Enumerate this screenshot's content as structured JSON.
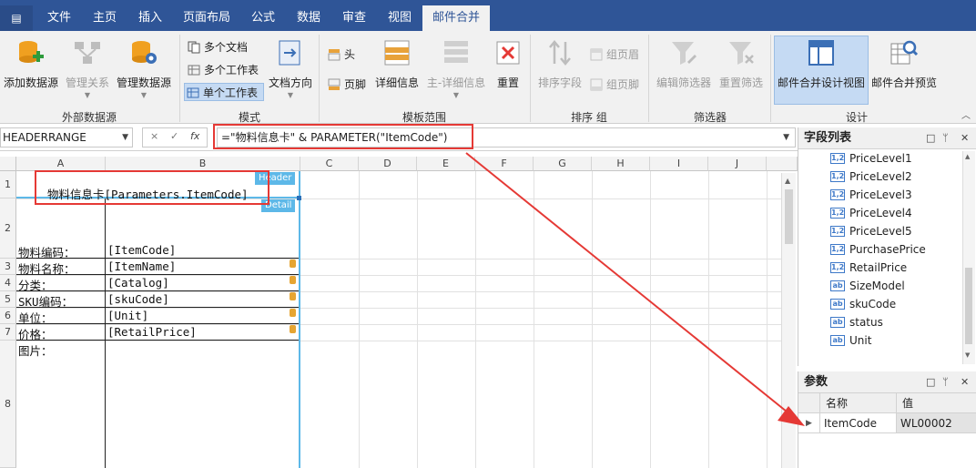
{
  "app_menu_label": "▤",
  "tabs": [
    {
      "label": "文件"
    },
    {
      "label": "主页"
    },
    {
      "label": "插入"
    },
    {
      "label": "页面布局"
    },
    {
      "label": "公式"
    },
    {
      "label": "数据"
    },
    {
      "label": "审查"
    },
    {
      "label": "视图"
    },
    {
      "label": "邮件合并",
      "active": true
    }
  ],
  "ribbon": {
    "groups": {
      "external_data": "外部数据源",
      "mode": "模式",
      "template_range": "模板范围",
      "sort_group": "排序   组",
      "filter": "筛选器",
      "design": "设计"
    },
    "buttons": {
      "add_datasource": "添加数据源",
      "manage_relations": "管理关系",
      "manage_datasource": "管理数据源",
      "multi_doc": "多个文档",
      "multi_sheet": "多个工作表",
      "single_sheet": "单个工作表",
      "doc_direction": "文档方向",
      "header": "头",
      "footer": "页脚",
      "detail": "详细信息",
      "master_detail": "主-详细信息",
      "reset": "重置",
      "sort_field": "排序字段",
      "group_header": "组页眉",
      "group_footer": "组页脚",
      "edit_filter": "编辑筛选器",
      "reset_filter": "重置筛选",
      "design_view": "邮件合并设计视图",
      "preview": "邮件合并预览"
    }
  },
  "formula_bar": {
    "name_box": "HEADERRANGE",
    "cancel": "×",
    "confirm": "✓",
    "fx": "fx",
    "formula": "=\"物料信息卡\" & PARAMETER(\"ItemCode\")"
  },
  "sheet": {
    "columns": [
      "A",
      "B",
      "C",
      "D",
      "E",
      "F",
      "G",
      "H",
      "I",
      "J"
    ],
    "rows": [
      "1",
      "2",
      "3",
      "4",
      "5",
      "6",
      "7",
      "8"
    ],
    "header_title": "物料信息卡[Parameters.ItemCode]",
    "badge_header": "Header",
    "badge_detail": "Detail",
    "labels": {
      "item_code": "物料编码：",
      "item_name": "物料名称：",
      "catalog": "分类：",
      "sku_code": "SKU编码：",
      "unit": "单位：",
      "price": "价格：",
      "picture": "图片："
    },
    "fields": {
      "item_code": "[ItemCode]",
      "item_name": "[ItemName]",
      "catalog": "[Catalog]",
      "sku_code": "[skuCode]",
      "unit": "[Unit]",
      "price": "[RetailPrice]"
    }
  },
  "field_list": {
    "title": "字段列表",
    "items": [
      {
        "name": "PriceLevel1",
        "type": "1,2"
      },
      {
        "name": "PriceLevel2",
        "type": "1,2"
      },
      {
        "name": "PriceLevel3",
        "type": "1,2"
      },
      {
        "name": "PriceLevel4",
        "type": "1,2"
      },
      {
        "name": "PriceLevel5",
        "type": "1,2"
      },
      {
        "name": "PurchasePrice",
        "type": "1,2"
      },
      {
        "name": "RetailPrice",
        "type": "1,2"
      },
      {
        "name": "SizeModel",
        "type": "ab"
      },
      {
        "name": "skuCode",
        "type": "ab"
      },
      {
        "name": "status",
        "type": "ab"
      },
      {
        "name": "Unit",
        "type": "ab"
      }
    ]
  },
  "params": {
    "title": "参数",
    "col_name": "名称",
    "col_value": "值",
    "rows": [
      {
        "name": "ItemCode",
        "value": "WL00002"
      }
    ]
  },
  "colors": {
    "accent": "#2f5597",
    "highlight": "#e53935",
    "badge": "#5db8e8"
  }
}
